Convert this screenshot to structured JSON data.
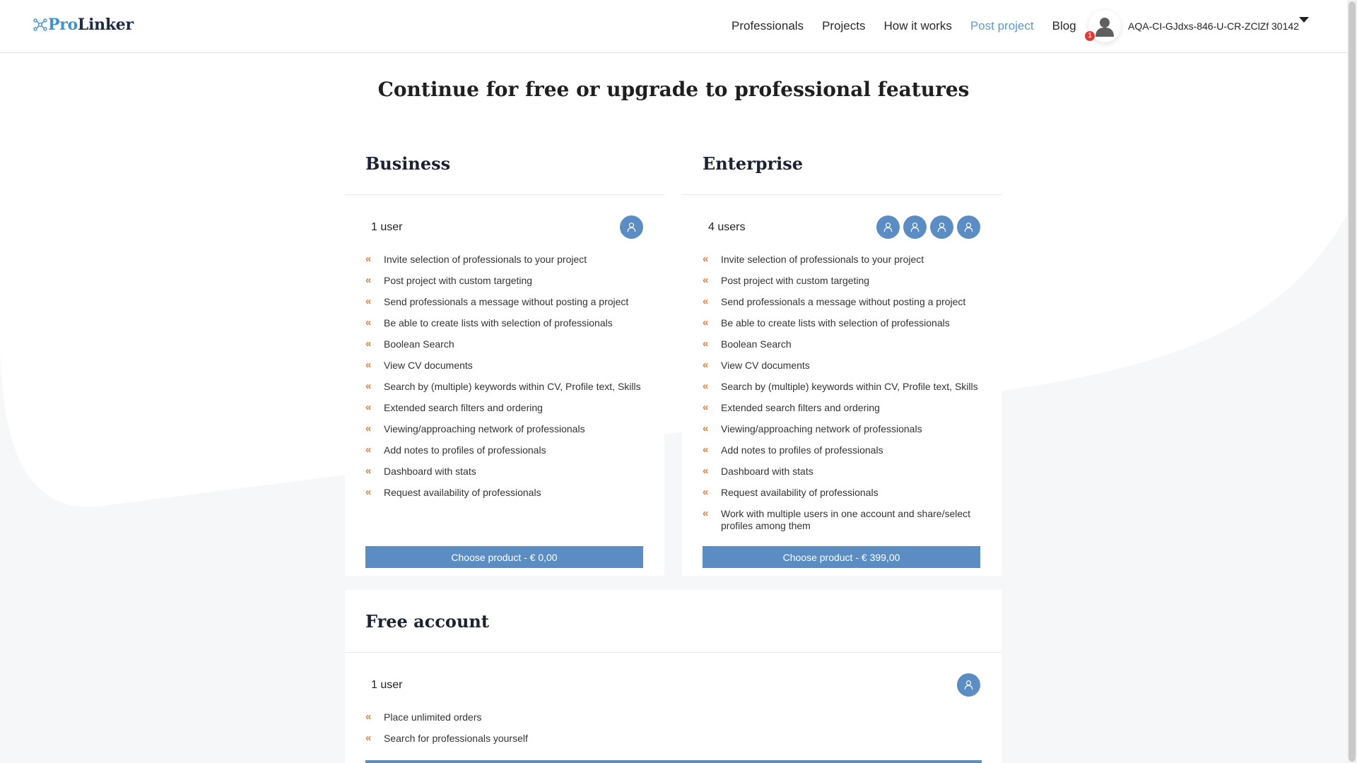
{
  "brand": {
    "pro": "Pro",
    "linker": "Linker"
  },
  "nav": [
    {
      "label": "Professionals",
      "active": false
    },
    {
      "label": "Projects",
      "active": false
    },
    {
      "label": "How it works",
      "active": false
    },
    {
      "label": "Post project",
      "active": true
    },
    {
      "label": "Blog",
      "active": false
    }
  ],
  "user": {
    "name": "AQA-CI-GJdxs-846-U-CR-ZClZf 30142",
    "notifications": "1"
  },
  "title": "Continue for free or upgrade to professional features",
  "plans": {
    "business": {
      "title": "Business",
      "users_label": "1 user",
      "features": [
        "Invite selection of professionals to your project",
        "Post project with custom targeting",
        "Send professionals a message without posting a project",
        "Be able to create lists with selection of professionals",
        "Boolean Search",
        "View CV documents",
        "Search by (multiple) keywords within CV, Profile text, Skills",
        "Extended search filters and ordering",
        "Viewing/approaching network of professionals",
        "Add notes to profiles of professionals",
        "Dashboard with stats",
        "Request availability of professionals"
      ],
      "button": "Choose product - € 0,00"
    },
    "enterprise": {
      "title": "Enterprise",
      "users_label": "4 users",
      "features": [
        "Invite selection of professionals to your project",
        "Post project with custom targeting",
        "Send professionals a message without posting a project",
        "Be able to create lists with selection of professionals",
        "Boolean Search",
        "View CV documents",
        "Search by (multiple) keywords within CV, Profile text, Skills",
        "Extended search filters and ordering",
        "Viewing/approaching network of professionals",
        "Add notes to profiles of professionals",
        "Dashboard with stats",
        "Request availability of professionals",
        "Work with multiple users in one account and share/select profiles among them"
      ],
      "button": "Choose product - € 399,00"
    },
    "free": {
      "title": "Free account",
      "users_label": "1 user",
      "features": [
        "Place unlimited orders",
        "Search for professionals yourself"
      ]
    }
  },
  "colors": {
    "accent": "#5b8dc4",
    "bullet": "#e67e3b",
    "nav_active": "#5a9bd5",
    "badge": "#e53935"
  },
  "icons": {
    "bullet": "double-chevron-left-icon",
    "user": "user-icon",
    "caret": "caret-down-icon",
    "logo": "network-icon"
  }
}
